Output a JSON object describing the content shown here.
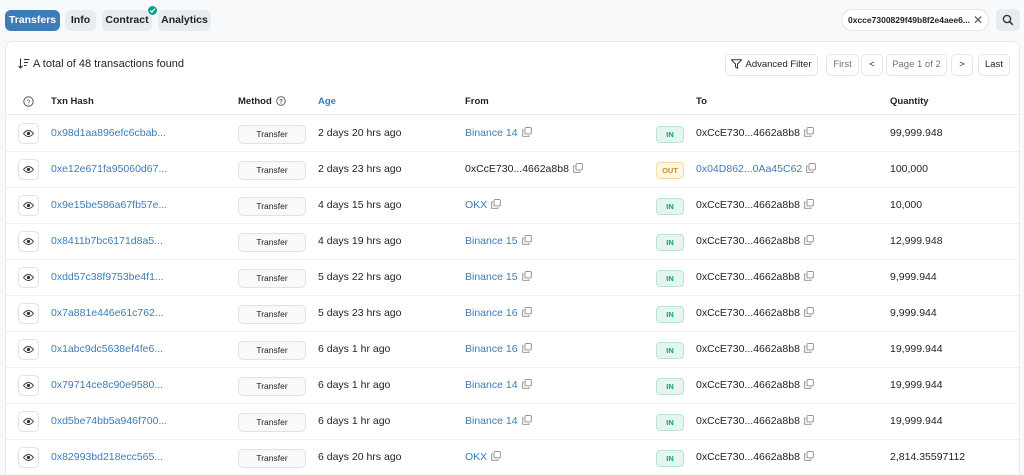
{
  "tabs": [
    {
      "label": "Transfers",
      "active": true
    },
    {
      "label": "Info",
      "active": false
    },
    {
      "label": "Contract",
      "active": false,
      "verified": true
    },
    {
      "label": "Analytics",
      "active": false
    }
  ],
  "address_filter": {
    "value": "0xcce7300829f49b8f2e4aee6...",
    "close_icon": "close-icon"
  },
  "search_icon": "search-icon",
  "summary": {
    "text": "A total of 48 transactions found"
  },
  "toolbar": {
    "advanced_filter": "Advanced Filter",
    "first": "First",
    "prev": "<",
    "page": "Page 1 of 2",
    "next": ">",
    "last": "Last"
  },
  "columns": {
    "hash": "Txn Hash",
    "method": "Method",
    "age": "Age",
    "from": "From",
    "to": "To",
    "quantity": "Quantity"
  },
  "rows": [
    {
      "hash": "0x98d1aa896efc6cbab...",
      "method": "Transfer",
      "age": "2 days 20 hrs ago",
      "from": "Binance 14",
      "from_link": true,
      "dir": "IN",
      "to": "0xCcE730...4662a8b8",
      "to_link": false,
      "qty": "99,999.948"
    },
    {
      "hash": "0xe12e671fa95060d67...",
      "method": "Transfer",
      "age": "2 days 23 hrs ago",
      "from": "0xCcE730...4662a8b8",
      "from_link": false,
      "dir": "OUT",
      "to": "0x04D862...0Aa45C62",
      "to_link": true,
      "qty": "100,000"
    },
    {
      "hash": "0x9e15be586a67fb57e...",
      "method": "Transfer",
      "age": "4 days 15 hrs ago",
      "from": "OKX",
      "from_link": true,
      "dir": "IN",
      "to": "0xCcE730...4662a8b8",
      "to_link": false,
      "qty": "10,000"
    },
    {
      "hash": "0x8411b7bc6171d8a5...",
      "method": "Transfer",
      "age": "4 days 19 hrs ago",
      "from": "Binance 15",
      "from_link": true,
      "dir": "IN",
      "to": "0xCcE730...4662a8b8",
      "to_link": false,
      "qty": "12,999.948"
    },
    {
      "hash": "0xdd57c38f9753be4f1...",
      "method": "Transfer",
      "age": "5 days 22 hrs ago",
      "from": "Binance 15",
      "from_link": true,
      "dir": "IN",
      "to": "0xCcE730...4662a8b8",
      "to_link": false,
      "qty": "9,999.944"
    },
    {
      "hash": "0x7a881e446e61c762...",
      "method": "Transfer",
      "age": "5 days 23 hrs ago",
      "from": "Binance 16",
      "from_link": true,
      "dir": "IN",
      "to": "0xCcE730...4662a8b8",
      "to_link": false,
      "qty": "9,999.944"
    },
    {
      "hash": "0x1abc9dc5638ef4fe6...",
      "method": "Transfer",
      "age": "6 days 1 hr ago",
      "from": "Binance 16",
      "from_link": true,
      "dir": "IN",
      "to": "0xCcE730...4662a8b8",
      "to_link": false,
      "qty": "19,999.944"
    },
    {
      "hash": "0x79714ce8c90e9580...",
      "method": "Transfer",
      "age": "6 days 1 hr ago",
      "from": "Binance 14",
      "from_link": true,
      "dir": "IN",
      "to": "0xCcE730...4662a8b8",
      "to_link": false,
      "qty": "19,999.944"
    },
    {
      "hash": "0xd5be74bb5a946f700...",
      "method": "Transfer",
      "age": "6 days 1 hr ago",
      "from": "Binance 14",
      "from_link": true,
      "dir": "IN",
      "to": "0xCcE730...4662a8b8",
      "to_link": false,
      "qty": "19,999.944"
    },
    {
      "hash": "0x82993bd218ecc565...",
      "method": "Transfer",
      "age": "6 days 20 hrs ago",
      "from": "OKX",
      "from_link": true,
      "dir": "IN",
      "to": "0xCcE730...4662a8b8",
      "to_link": false,
      "qty": "2,814.35597112"
    }
  ],
  "colors": {
    "accent": "#3d7cb6",
    "in": "#00a186",
    "out": "#c49314"
  }
}
